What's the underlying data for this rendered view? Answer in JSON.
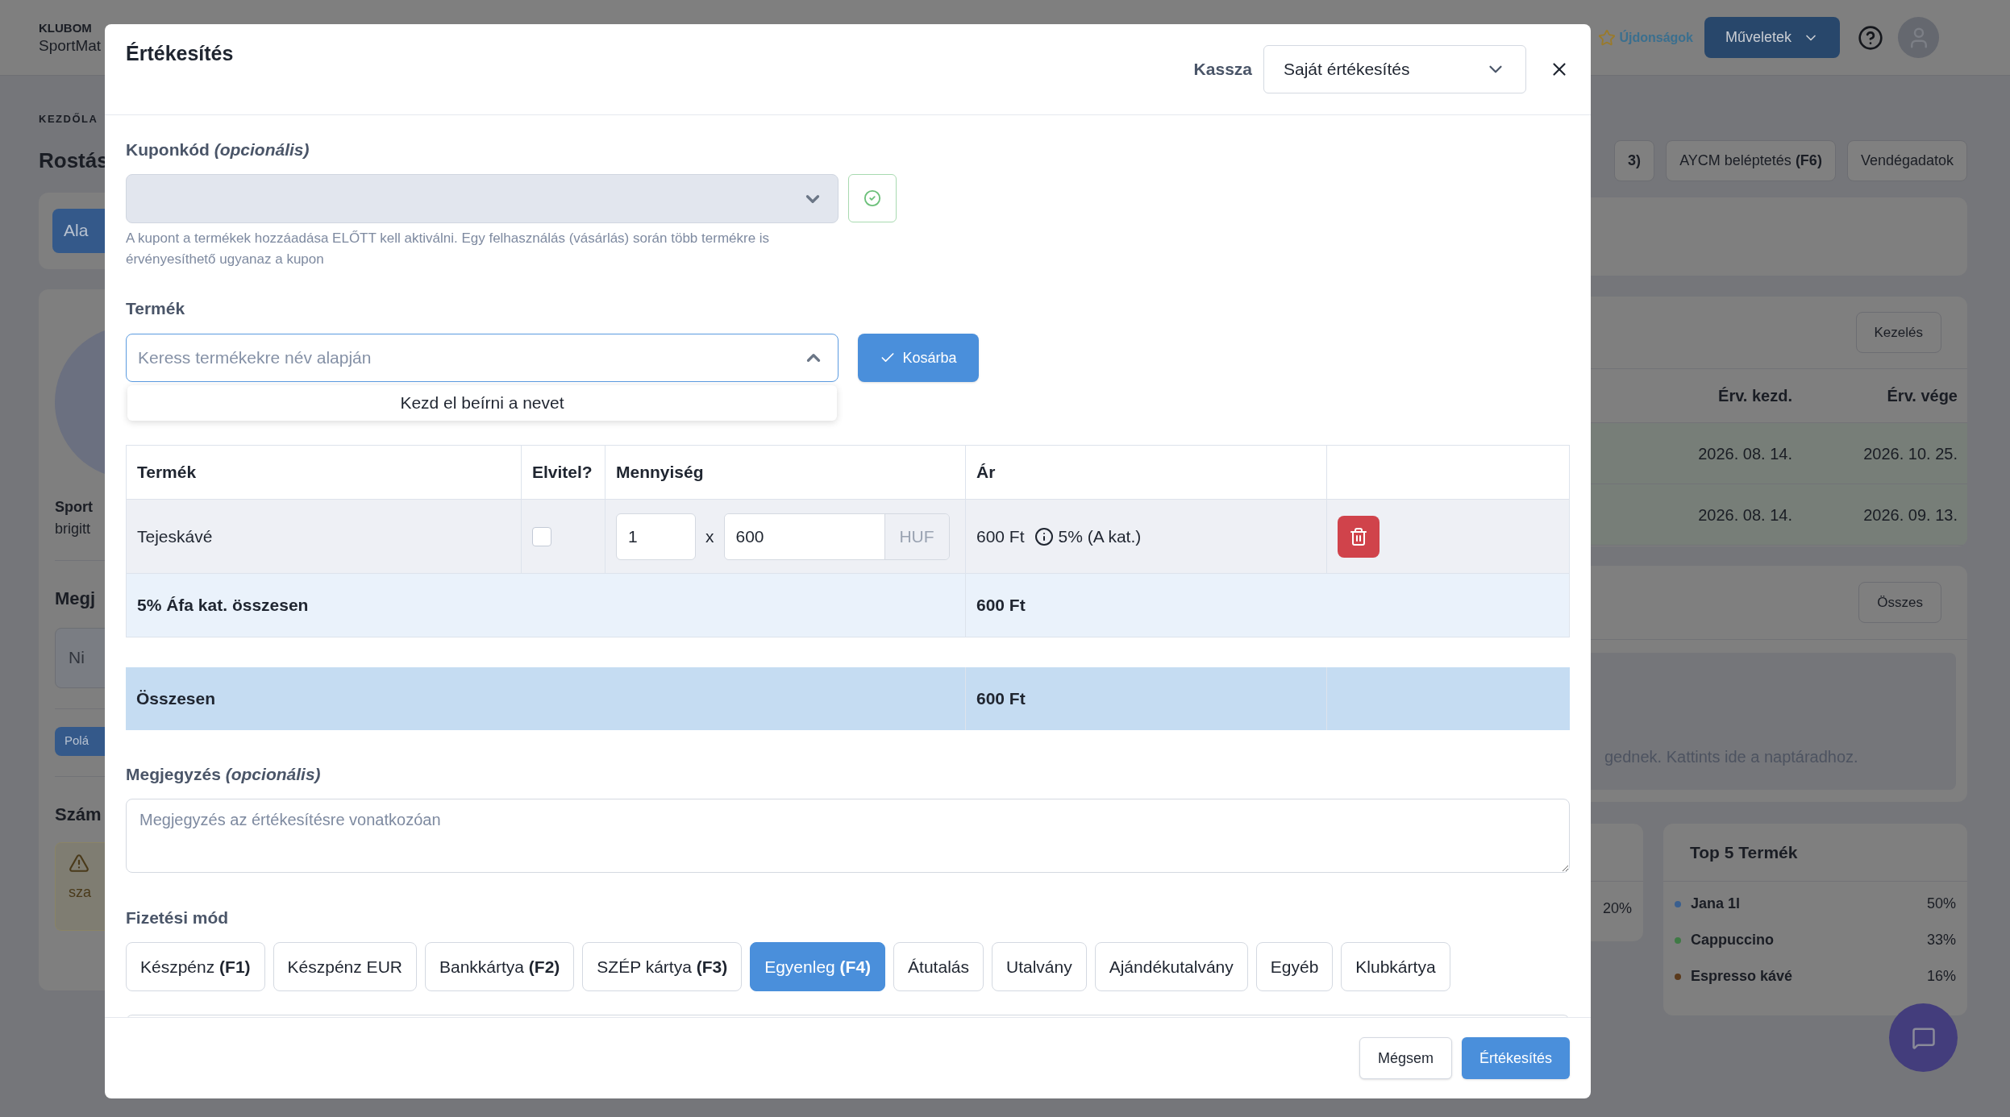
{
  "background": {
    "brand": {
      "line1": "KLUBOM",
      "line2": "SportMat"
    },
    "header": {
      "news": "Újdonságok",
      "actions": "Műveletek"
    },
    "breadcrumb": "KEZDŐLA",
    "page_title": "Rostás",
    "left": {
      "tab_button": "Ala",
      "name": "Sport",
      "email": "brigitt",
      "note_title": "Megj",
      "note_value": "Ni",
      "badge": "Polá",
      "section_title": "Szám",
      "warning": "sza"
    },
    "quick_buttons": [
      {
        "label": "**3)**"
      },
      {
        "label": "AYCM beléptetés **(F6)**"
      },
      {
        "label": "Vendégadatok"
      }
    ],
    "passes": {
      "manage": "Kezelés",
      "columns": [
        "Érv. kezd.",
        "Érv. vége"
      ],
      "rows": [
        [
          "2026. 08. 14.",
          "2026. 10. 25."
        ],
        [
          "2026. 08. 14.",
          "2026. 09. 13."
        ]
      ]
    },
    "calendar": {
      "all": "Összes",
      "hint": "gednek. Kattints ide a naptáradhoz."
    },
    "partial_stat": "20%",
    "top5": {
      "title": "Top 5 Termék",
      "items": [
        {
          "name": "Jana 1l",
          "share": "50%",
          "color": "#3a5f8f"
        },
        {
          "name": "Cappuccino",
          "share": "33%",
          "color": "#3f7a45"
        },
        {
          "name": "Espresso kávé",
          "share": "16%",
          "color": "#5a3a1c"
        }
      ]
    }
  },
  "modal": {
    "title": "Értékesítés",
    "register_label": "Kassza",
    "register_value": "Saját értékesítés",
    "coupon": {
      "label": "Kuponkód *(opcionális)*",
      "hint": "A kupont a termékek hozzáadása ELŐTT kell aktiválni. Egy felhasználás (vásárlás) során több termékre is érvényesíthető ugyanaz a kupon"
    },
    "product": {
      "label": "Termék",
      "placeholder": "Keress termékekre név alapján",
      "add_button": "Kosárba",
      "dropdown_message": "Kezd el beírni a nevet"
    },
    "cart": {
      "columns": [
        "Termék",
        "Elvitel?",
        "Mennyiség",
        "Ár"
      ],
      "rows": [
        {
          "product": "Tejeskávé",
          "takeaway": false,
          "quantity": "1",
          "multiply": "x",
          "unit_price": "600",
          "currency": "HUF",
          "price": "600 Ft",
          "vat": "5% (A kat.)"
        }
      ],
      "vat_total": {
        "label": "5% Áfa kat. összesen",
        "value": "600 Ft"
      },
      "total": {
        "label": "Összesen",
        "value": "600 Ft"
      }
    },
    "note": {
      "label": "Megjegyzés *(opcionális)*",
      "placeholder": "Megjegyzés az értékesítésre vonatkozóan"
    },
    "payment": {
      "label": "Fizetési mód",
      "methods": [
        {
          "label": "Készpénz **(F1)**",
          "selected": false
        },
        {
          "label": "Készpénz EUR",
          "selected": false
        },
        {
          "label": "Bankkártya **(F2)**",
          "selected": false
        },
        {
          "label": "SZÉP kártya **(F3)**",
          "selected": false
        },
        {
          "label": "Egyenleg **(F4)**",
          "selected": true
        },
        {
          "label": "Átutalás",
          "selected": false
        },
        {
          "label": "Utalvány",
          "selected": false
        },
        {
          "label": "Ajándékutalvány",
          "selected": false
        },
        {
          "label": "Egyéb",
          "selected": false
        },
        {
          "label": "Klubkártya",
          "selected": false
        }
      ]
    },
    "buttons": {
      "cancel": "Mégsem",
      "submit": "Értékesítés"
    }
  }
}
